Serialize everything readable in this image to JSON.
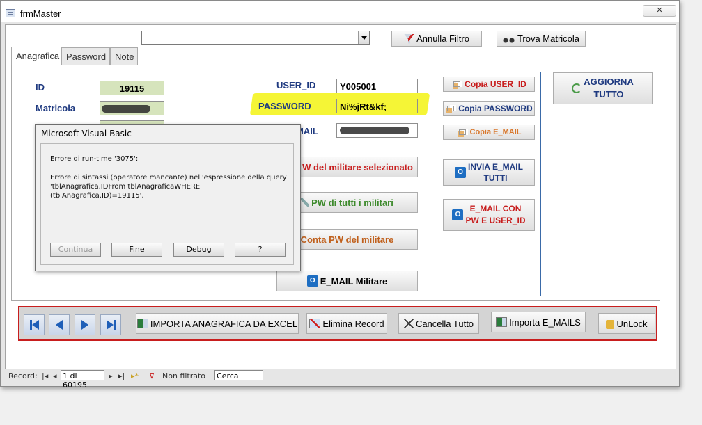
{
  "window": {
    "title": "frmMaster",
    "close_glyph": "✕"
  },
  "toolbar": {
    "filter_value": "",
    "clear_filter_label": "Annulla Filtro",
    "find_label": "Trova Matricola"
  },
  "tabs": [
    {
      "label": "Anagrafica",
      "active": true
    },
    {
      "label": "Password",
      "active": false
    },
    {
      "label": "Note",
      "active": false
    }
  ],
  "fields": {
    "id": {
      "label": "ID",
      "value": "19115"
    },
    "matricola": {
      "label": "Matricola",
      "value": ""
    },
    "user_id": {
      "label": "USER_ID",
      "value": "Y005001"
    },
    "password": {
      "label": "PASSWORD",
      "value": "Ni%jRt&kf;"
    },
    "email": {
      "label": "MAIL",
      "value": ""
    }
  },
  "buttons": {
    "pw_selected": "W del militare selezionato",
    "pw_all": "PW di tutti i militari",
    "count_pw": "Conta PW del militare",
    "email_militare": "E_MAIL Militare",
    "copy_user_id": "Copia USER_ID",
    "copy_password": "Copia PASSWORD",
    "copy_email": "Copia E_MAIL",
    "send_all_1": "INVIA E_MAIL",
    "send_all_2": "TUTTI",
    "email_pw_1": "E_MAIL CON",
    "email_pw_2": "PW  E USER_ID",
    "update_all_1": "AGGIORNA",
    "update_all_2": "TUTTO"
  },
  "bottom_bar": {
    "import_excel": "IMPORTA ANAGRAFICA DA EXCEL",
    "delete_record": "Elimina Record",
    "clear_all": "Cancella Tutto",
    "import_emails": "Importa E_MAILS",
    "unlock": "UnLock"
  },
  "dialog": {
    "title": "Microsoft Visual Basic",
    "error_code": "Errore di run-time '3075':",
    "message": "Errore di sintassi (operatore mancante) nell'espressione della query\n'tblAnagrafica.IDFrom tblAnagraficaWHERE\n(tblAnagrafica.ID)=19115'.",
    "buttons": [
      "Continua",
      "Fine",
      "Debug",
      "?"
    ]
  },
  "status": {
    "record_label": "Record:",
    "record_position": "1 di 60195",
    "filter_state": "Non filtrato",
    "search_placeholder": "Cerca"
  },
  "colors": {
    "label_blue": "#1f3a80",
    "highlight_yellow": "#f5f536",
    "accent_red": "#c81e1e",
    "field_green": "#d6e4bc"
  }
}
